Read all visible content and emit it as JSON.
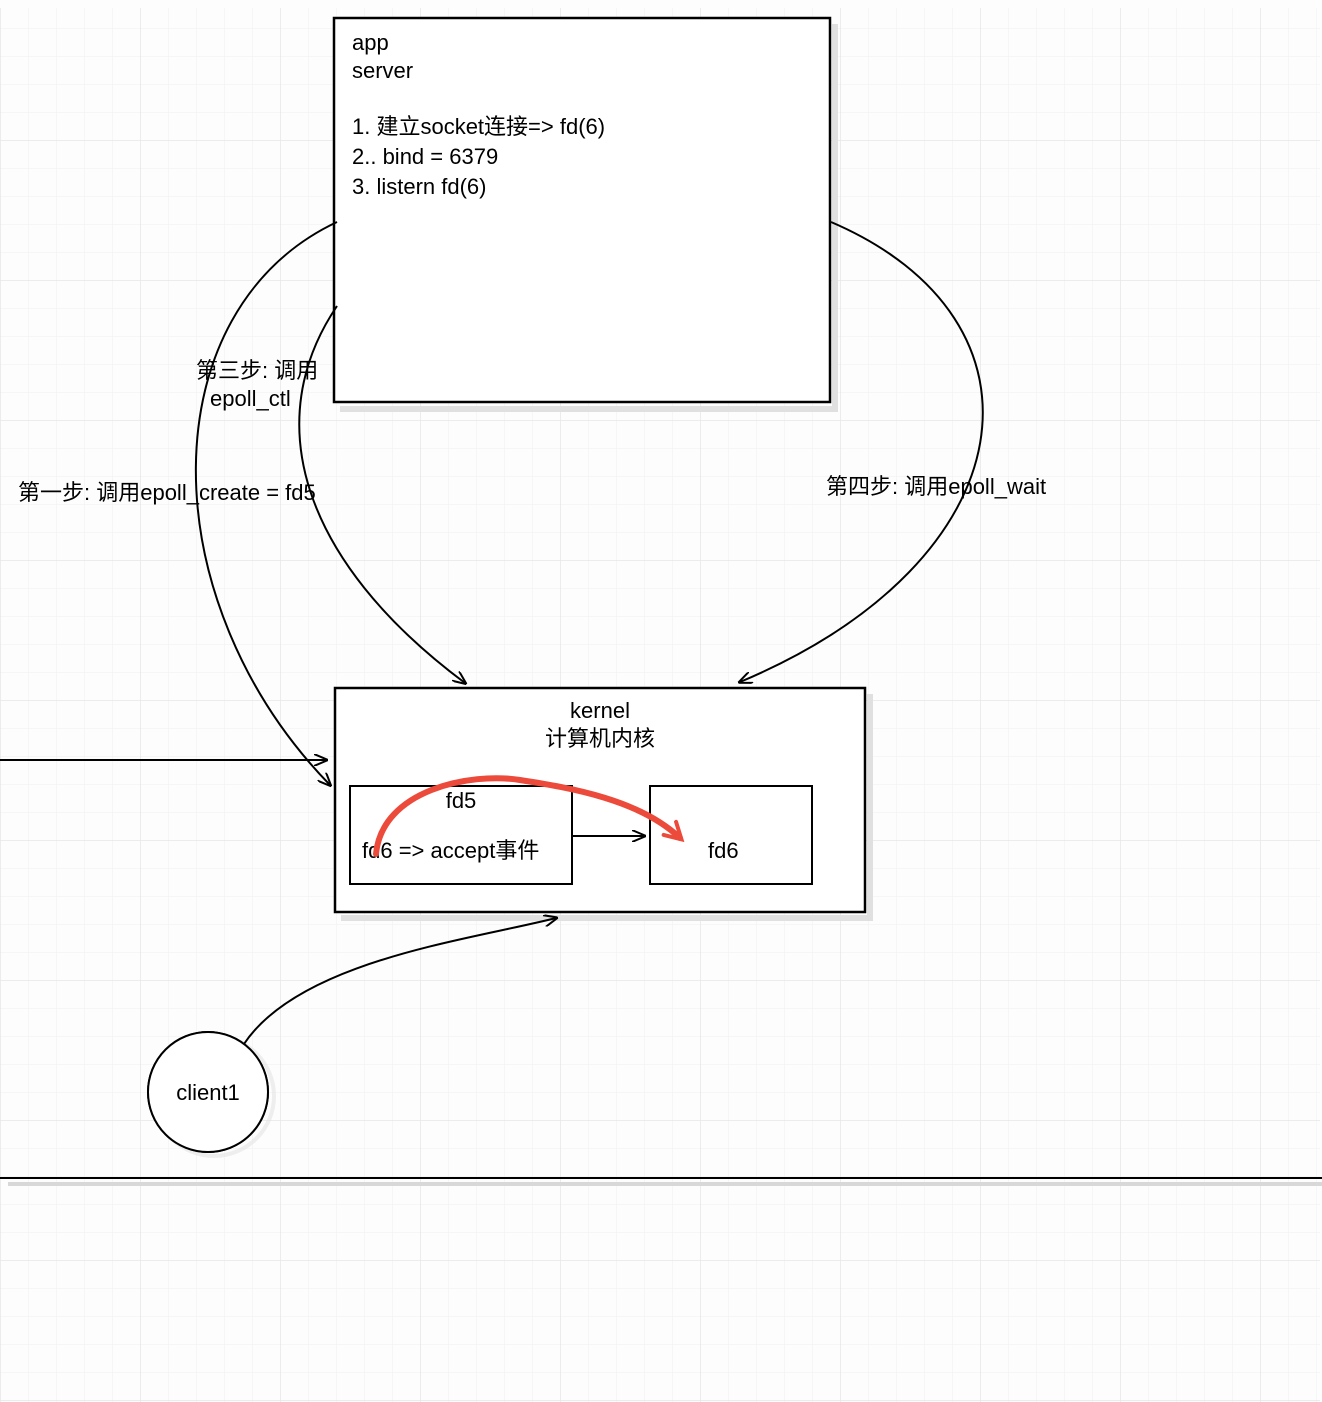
{
  "app_box": {
    "line1": "app",
    "line2": "server",
    "step1": "1. 建立socket连接=> fd(6)",
    "step2": "2.. bind = 6379",
    "step3": "3. listern fd(6)"
  },
  "labels": {
    "step1_label_a": "第一步: 调用epoll_create = fd5",
    "step3_label_a": "第三步: 调用",
    "step3_label_b": "epoll_ctl",
    "step4_label": "第四步: 调用epoll_wait"
  },
  "kernel": {
    "title1": "kernel",
    "title2": "计算机内核",
    "fd5_label": "fd5",
    "fd5_content": "fd6 => accept事件",
    "fd6_label": "fd6"
  },
  "client": {
    "label": "client1"
  }
}
